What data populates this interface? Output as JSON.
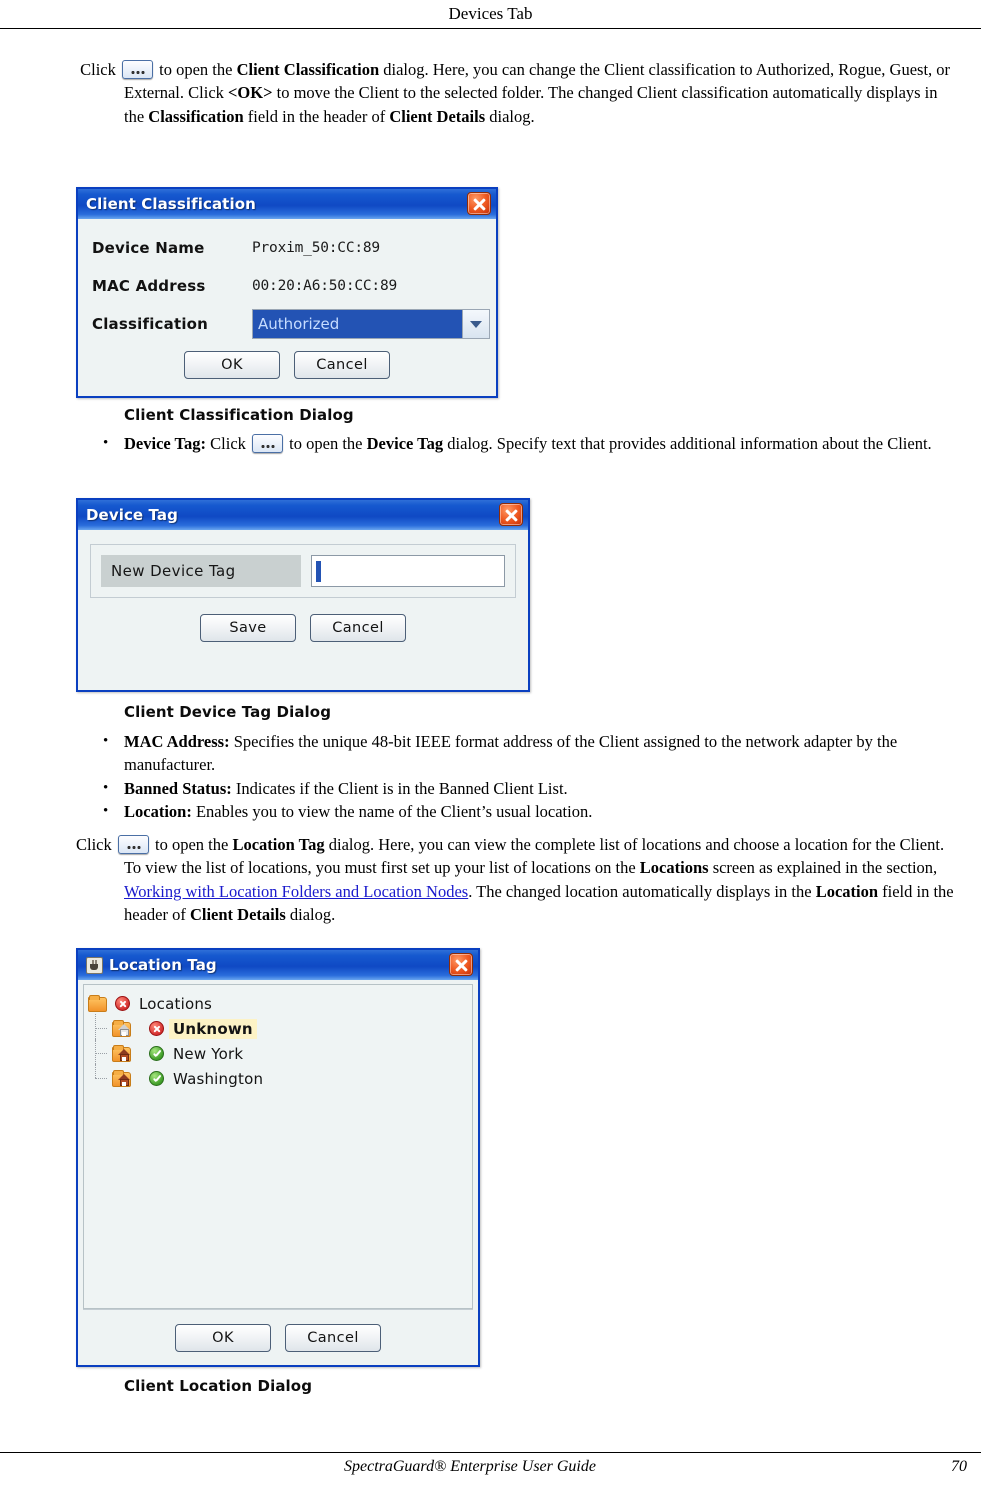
{
  "header": {
    "title": "Devices Tab"
  },
  "footer": {
    "guide": "SpectraGuard® Enterprise User Guide",
    "page": "70"
  },
  "paragraphs": {
    "classification": {
      "p1_a": "Click",
      "p1_b": "to open the",
      "p1_bold1": "Client Classification",
      "p1_c": "dialog. Here, you can change the Client classification to Authorized, Rogue, Guest, or External. Click",
      "p1_bold2": "<OK>",
      "p1_d": "to move the Client to the selected folder. The changed Client classification automatically displays in the",
      "p1_bold3": "Classification",
      "p1_e": "field in the header of",
      "p1_bold4": "Client Details",
      "p1_f": "dialog."
    },
    "location": {
      "p_a": "Click",
      "p_b": "to open the",
      "p_bold1": "Location Tag",
      "p_c": "dialog. Here, you can view the complete list of locations and choose a location for the Client. To view the list of locations, you must first set up your list of locations on the",
      "p_bold2": "Locations",
      "p_d": "screen as explained in the section,",
      "p_link": "Working with Location Folders and Location Nodes",
      "p_e": ". The changed location automatically displays in the",
      "p_bold3": "Location",
      "p_f": "field in the header of",
      "p_bold4": "Client Details",
      "p_g": "dialog."
    }
  },
  "bullets": {
    "device_tag": {
      "term": "Device Tag:",
      "text_a": "Click",
      "text_b": "to open the",
      "bold": "Device Tag",
      "text_c": "dialog. Specify text that provides additional information about the Client."
    },
    "mac_address": {
      "term": "MAC Address:",
      "text": "Specifies the unique 48-bit IEEE format address of the Client assigned to the network adapter by the manufacturer."
    },
    "banned_status": {
      "term": "Banned Status:",
      "text": "Indicates if the Client is in the Banned Client List."
    },
    "location": {
      "term": "Location:",
      "text": "Enables you to view the name of the Client’s usual location."
    },
    "marker": "•"
  },
  "dialogs": {
    "client_classification": {
      "title": "Client Classification",
      "fields": [
        {
          "label": "Device Name",
          "value": "Proxim_50:CC:89"
        },
        {
          "label": "MAC Address",
          "value": "00:20:A6:50:CC:89"
        }
      ],
      "classification_label": "Classification",
      "classification_value": "Authorized",
      "ok_label": "OK",
      "cancel_label": "Cancel",
      "caption": "Client Classification Dialog"
    },
    "device_tag": {
      "title": "Device Tag",
      "field_label": "New  Device Tag",
      "field_value": "",
      "field_placeholder": "",
      "save_label": "Save",
      "cancel_label": "Cancel",
      "caption": "Client Device Tag Dialog"
    },
    "location_tag": {
      "title": "Location Tag",
      "tree": [
        {
          "label": "Locations",
          "status": "red",
          "level": 0,
          "selected": false
        },
        {
          "label": "Unknown",
          "status": "red",
          "level": 1,
          "selected": true
        },
        {
          "label": "New York",
          "status": "green",
          "level": 1,
          "selected": false
        },
        {
          "label": "Washington",
          "status": "green",
          "level": 1,
          "selected": false
        }
      ],
      "ok_label": "OK",
      "cancel_label": "Cancel",
      "caption": "Client Location Dialog"
    }
  },
  "colors": {
    "title_bar": "#0f49c4",
    "close_button": "#ef5a22",
    "selection": "#2353b4",
    "tree_highlight": "#fdf3c6",
    "link": "#1a1acc"
  }
}
